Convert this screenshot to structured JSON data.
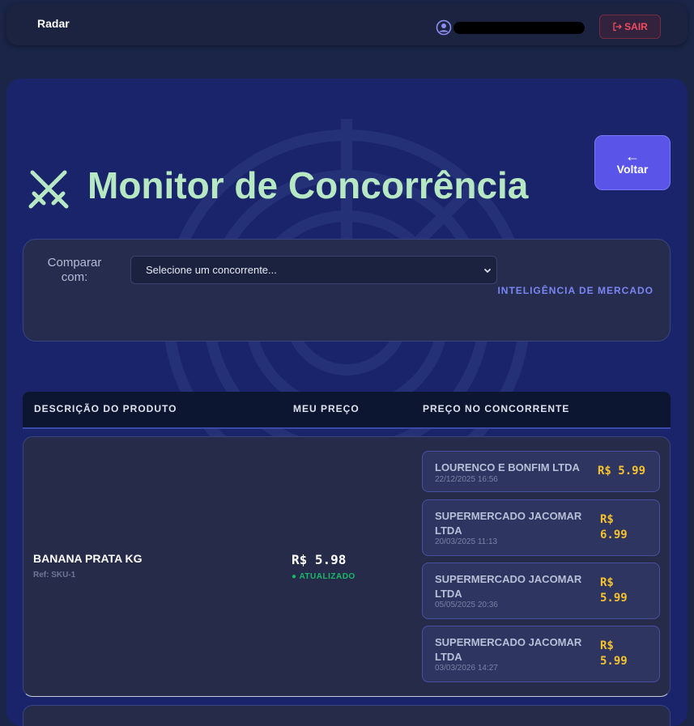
{
  "topbar": {
    "brand": "Radar",
    "logout_label": "SAIR",
    "user_icon": "user-circle-icon"
  },
  "page": {
    "title": "Monitor de Concorrência",
    "title_icon": "crossed-swords-icon",
    "back_label": "Voltar",
    "back_arrow": "←"
  },
  "filter": {
    "label": "Comparar com:",
    "select_placeholder": "Selecione um concorrente...",
    "market_intel": "INTELIGÊNCIA DE MERCADO"
  },
  "table": {
    "headers": [
      "DESCRIÇÃO DO PRODUTO",
      "MEU PREÇO",
      "PREÇO NO CONCORRENTE"
    ],
    "rows": [
      {
        "name": "BANANA PRATA KG",
        "ref": "Ref: SKU-1",
        "my_price": "R$ 5.98",
        "status": "● ATUALIZADO",
        "competitors": [
          {
            "name": "LOURENCO E BONFIM LTDA",
            "date": "22/12/2025 16:56",
            "price": "R$ 5.99"
          },
          {
            "name": "SUPERMERCADO JACOMAR LTDA",
            "date": "20/03/2025 11:13",
            "price": "R$ 6.99"
          },
          {
            "name": "SUPERMERCADO JACOMAR LTDA",
            "date": "05/05/2025 20:36",
            "price": "R$ 5.99"
          },
          {
            "name": "SUPERMERCADO JACOMAR LTDA",
            "date": "03/03/2026 14:27",
            "price": "R$ 5.99"
          }
        ]
      }
    ]
  },
  "colors": {
    "background": "#1a2547",
    "panel": "#19246a",
    "title": "#b7e8c4",
    "accent": "#5a55e8",
    "price": "#f5c22e",
    "status_ok": "#19b86a",
    "danger": "#ef4d5e"
  }
}
